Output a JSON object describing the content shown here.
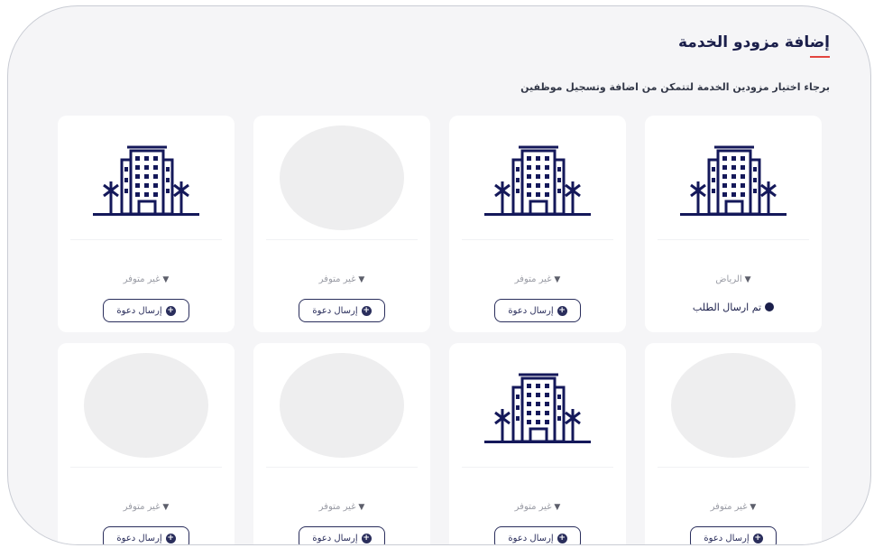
{
  "header": {
    "title": "إضافة مزودو الخدمة",
    "subtitle": "برجاء اختيار مزودين الخدمة لتتمكن من اضافة وتسجيل موظفين"
  },
  "colors": {
    "primary": "#1b1f4b",
    "accent": "#e2453f",
    "placeholder": "#eeeeef"
  },
  "cards": [
    {
      "image": "building-icon",
      "city": "الرياض",
      "status": "تم ارسال الطلب"
    },
    {
      "image": "building-icon",
      "city": "غير متوفر",
      "button": "إرسال دعوة"
    },
    {
      "image": "placeholder",
      "city": "غير متوفر",
      "button": "إرسال دعوة"
    },
    {
      "image": "building-icon",
      "city": "غير متوفر",
      "button": "إرسال دعوة"
    },
    {
      "image": "placeholder",
      "city": "غير متوفر",
      "button": "إرسال دعوة"
    },
    {
      "image": "building-icon",
      "city": "غير متوفر",
      "button": "إرسال دعوة"
    },
    {
      "image": "placeholder",
      "city": "غير متوفر",
      "button": "إرسال دعوة"
    },
    {
      "image": "placeholder",
      "city": "غير متوفر",
      "button": "إرسال دعوة"
    }
  ]
}
